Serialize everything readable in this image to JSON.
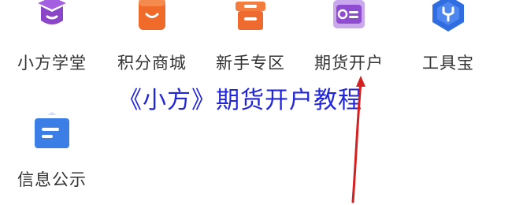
{
  "grid": {
    "items": [
      {
        "label": "小方学堂",
        "icon": "graduation-cap-icon",
        "color": "#8b45c7"
      },
      {
        "label": "积分商城",
        "icon": "shopping-bag-icon",
        "color": "#f06a2a"
      },
      {
        "label": "新手专区",
        "icon": "gift-box-icon",
        "color": "#ef6a2e"
      },
      {
        "label": "期货开户",
        "icon": "id-card-icon",
        "color": "#8e4cd0"
      },
      {
        "label": "工具宝",
        "icon": "toolbox-hexagon-icon",
        "color": "#2f6de0"
      },
      {
        "label": "信息公示",
        "icon": "document-icon",
        "color": "#3a7ee6"
      }
    ]
  },
  "overlay": {
    "title": "《小方》期货开户教程",
    "title_color": "#2226d9",
    "arrow_color": "#d42020"
  }
}
